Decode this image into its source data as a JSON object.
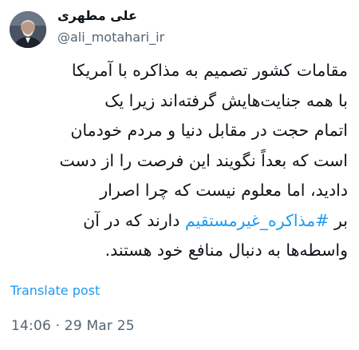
{
  "tweet": {
    "author": {
      "display_name": "علی مطهری",
      "handle": "@ali_motahari_ir",
      "avatar_icon": "profile-photo"
    },
    "text_lines": [
      "مقامات کشور تصمیم به مذاکره با آمریکا",
      "با همه جنایت‌هایش گرفته‌اند زیرا یک",
      "اتمام حجت در مقابل دنیا و مردم خودمان",
      "است که بعداً نگویند این فرصت را از دست",
      "دادید، اما معلوم نیست که چرا اصرار"
    ],
    "line6": {
      "before": "بر ",
      "hashtag": "#مذاکره_غیرمستقیم",
      "after": " دارند که در آن"
    },
    "line7": "واسطه‌ها به دنبال منافع خود هستند.",
    "translate_label": "Translate post",
    "timestamp": "14:06 · 29 Mar 25",
    "colors": {
      "link": "#1d9bf0",
      "muted": "#536471",
      "text": "#0f1419"
    }
  }
}
